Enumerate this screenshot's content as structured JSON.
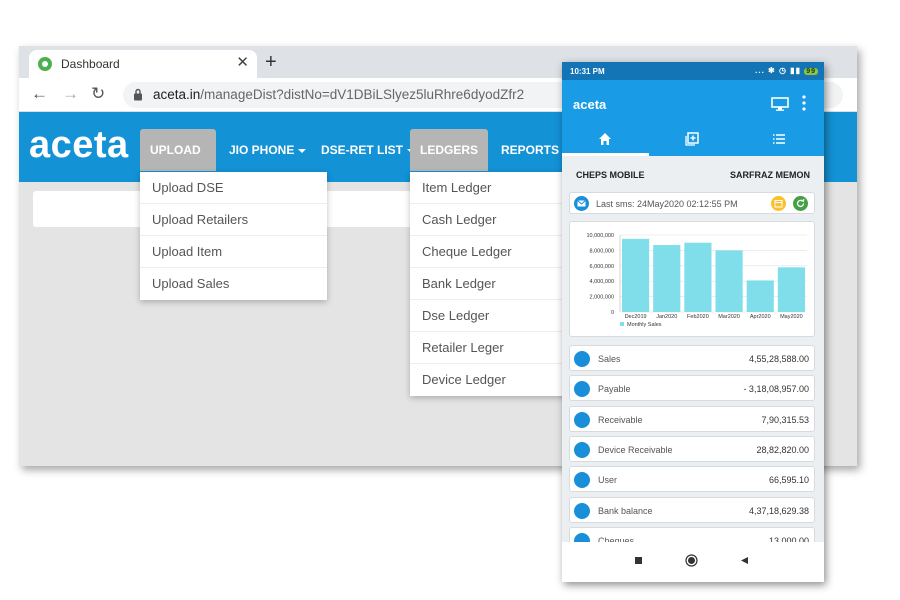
{
  "browser": {
    "tab_title": "Dashboard",
    "tab_close": "✕",
    "new_tab": "+",
    "url_host": "aceta.in",
    "url_path": "/manageDist?distNo=dV1DBiLSlyez5luRhre6dyodZfr2"
  },
  "site": {
    "logo": "aceta",
    "menu": {
      "upload": "UPLOAD",
      "jio_phone": "JIO PHONE",
      "dse_ret_list": "DSE-RET LIST",
      "ledgers": "LEDGERS",
      "reports": "REPORTS"
    },
    "upload_items": [
      "Upload DSE",
      "Upload Retailers",
      "Upload Item",
      "Upload Sales"
    ],
    "ledger_items": [
      "Item Ledger",
      "Cash Ledger",
      "Cheque Ledger",
      "Bank Ledger",
      "Dse Ledger",
      "Retailer Leger",
      "Device Ledger"
    ]
  },
  "phone": {
    "time": "10:31 PM",
    "status_icons": "... ✱ ◷ ▮▮",
    "battery": "99",
    "app_title": "aceta",
    "shop_name": "CHEPS MOBILE",
    "owner_name": "SARFRAZ MEMON",
    "last_sms": "Last sms: 24May2020 02:12:55 PM",
    "rows": [
      {
        "icon": "star-icon",
        "label": "Sales",
        "value": "4,55,28,588.00"
      },
      {
        "icon": "rupee-icon",
        "label": "Payable",
        "value": "- 3,18,08,957.00"
      },
      {
        "icon": "rupee-icon",
        "label": "Receivable",
        "value": "7,90,315.53"
      },
      {
        "icon": "circle-icon",
        "label": "Device Receivable",
        "value": "28,82,820.00"
      },
      {
        "icon": "user-card-icon",
        "label": "User",
        "value": "66,595.10"
      },
      {
        "icon": "bank-icon",
        "label": "Bank balance",
        "value": "4,37,18,629.38"
      },
      {
        "icon": "cheque-icon",
        "label": "Cheques",
        "value": "13,000.00"
      }
    ]
  },
  "colors": {
    "navbar": "#1392d6",
    "app_bar": "#1a9be6",
    "status_bar": "#1375b5",
    "bar_fill": "#80deea"
  },
  "chart_data": {
    "type": "bar",
    "categories": [
      "Dec2019",
      "Jan2020",
      "Feb2020",
      "Mar2020",
      "Apr2020",
      "May2020"
    ],
    "series": [
      {
        "name": "Monthly Sales",
        "values": [
          9500000,
          8700000,
          9000000,
          8000000,
          4100000,
          5800000
        ]
      }
    ],
    "yticks": [
      "0",
      "2,000,000",
      "4,000,000",
      "6,000,000",
      "8,000,000",
      "10,000,000"
    ],
    "ylim": [
      0,
      10000000
    ],
    "grid": true,
    "legend": "bottom-left"
  }
}
